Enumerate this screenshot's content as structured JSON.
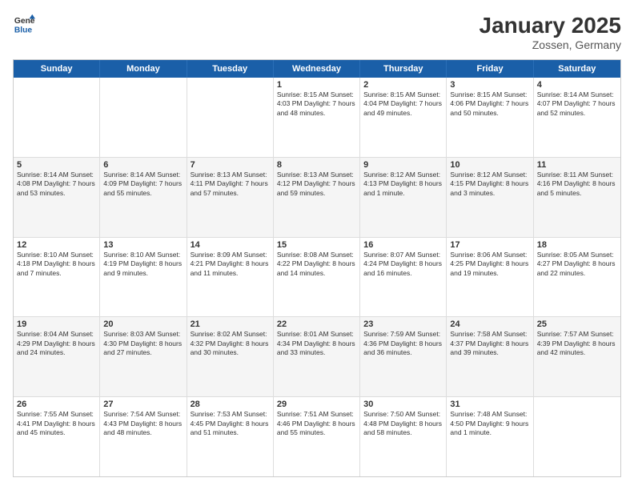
{
  "header": {
    "logo_line1": "General",
    "logo_line2": "Blue",
    "title": "January 2025",
    "subtitle": "Zossen, Germany"
  },
  "weekdays": [
    "Sunday",
    "Monday",
    "Tuesday",
    "Wednesday",
    "Thursday",
    "Friday",
    "Saturday"
  ],
  "rows": [
    [
      {
        "day": "",
        "text": ""
      },
      {
        "day": "",
        "text": ""
      },
      {
        "day": "",
        "text": ""
      },
      {
        "day": "1",
        "text": "Sunrise: 8:15 AM\nSunset: 4:03 PM\nDaylight: 7 hours\nand 48 minutes."
      },
      {
        "day": "2",
        "text": "Sunrise: 8:15 AM\nSunset: 4:04 PM\nDaylight: 7 hours\nand 49 minutes."
      },
      {
        "day": "3",
        "text": "Sunrise: 8:15 AM\nSunset: 4:06 PM\nDaylight: 7 hours\nand 50 minutes."
      },
      {
        "day": "4",
        "text": "Sunrise: 8:14 AM\nSunset: 4:07 PM\nDaylight: 7 hours\nand 52 minutes."
      }
    ],
    [
      {
        "day": "5",
        "text": "Sunrise: 8:14 AM\nSunset: 4:08 PM\nDaylight: 7 hours\nand 53 minutes."
      },
      {
        "day": "6",
        "text": "Sunrise: 8:14 AM\nSunset: 4:09 PM\nDaylight: 7 hours\nand 55 minutes."
      },
      {
        "day": "7",
        "text": "Sunrise: 8:13 AM\nSunset: 4:11 PM\nDaylight: 7 hours\nand 57 minutes."
      },
      {
        "day": "8",
        "text": "Sunrise: 8:13 AM\nSunset: 4:12 PM\nDaylight: 7 hours\nand 59 minutes."
      },
      {
        "day": "9",
        "text": "Sunrise: 8:12 AM\nSunset: 4:13 PM\nDaylight: 8 hours\nand 1 minute."
      },
      {
        "day": "10",
        "text": "Sunrise: 8:12 AM\nSunset: 4:15 PM\nDaylight: 8 hours\nand 3 minutes."
      },
      {
        "day": "11",
        "text": "Sunrise: 8:11 AM\nSunset: 4:16 PM\nDaylight: 8 hours\nand 5 minutes."
      }
    ],
    [
      {
        "day": "12",
        "text": "Sunrise: 8:10 AM\nSunset: 4:18 PM\nDaylight: 8 hours\nand 7 minutes."
      },
      {
        "day": "13",
        "text": "Sunrise: 8:10 AM\nSunset: 4:19 PM\nDaylight: 8 hours\nand 9 minutes."
      },
      {
        "day": "14",
        "text": "Sunrise: 8:09 AM\nSunset: 4:21 PM\nDaylight: 8 hours\nand 11 minutes."
      },
      {
        "day": "15",
        "text": "Sunrise: 8:08 AM\nSunset: 4:22 PM\nDaylight: 8 hours\nand 14 minutes."
      },
      {
        "day": "16",
        "text": "Sunrise: 8:07 AM\nSunset: 4:24 PM\nDaylight: 8 hours\nand 16 minutes."
      },
      {
        "day": "17",
        "text": "Sunrise: 8:06 AM\nSunset: 4:25 PM\nDaylight: 8 hours\nand 19 minutes."
      },
      {
        "day": "18",
        "text": "Sunrise: 8:05 AM\nSunset: 4:27 PM\nDaylight: 8 hours\nand 22 minutes."
      }
    ],
    [
      {
        "day": "19",
        "text": "Sunrise: 8:04 AM\nSunset: 4:29 PM\nDaylight: 8 hours\nand 24 minutes."
      },
      {
        "day": "20",
        "text": "Sunrise: 8:03 AM\nSunset: 4:30 PM\nDaylight: 8 hours\nand 27 minutes."
      },
      {
        "day": "21",
        "text": "Sunrise: 8:02 AM\nSunset: 4:32 PM\nDaylight: 8 hours\nand 30 minutes."
      },
      {
        "day": "22",
        "text": "Sunrise: 8:01 AM\nSunset: 4:34 PM\nDaylight: 8 hours\nand 33 minutes."
      },
      {
        "day": "23",
        "text": "Sunrise: 7:59 AM\nSunset: 4:36 PM\nDaylight: 8 hours\nand 36 minutes."
      },
      {
        "day": "24",
        "text": "Sunrise: 7:58 AM\nSunset: 4:37 PM\nDaylight: 8 hours\nand 39 minutes."
      },
      {
        "day": "25",
        "text": "Sunrise: 7:57 AM\nSunset: 4:39 PM\nDaylight: 8 hours\nand 42 minutes."
      }
    ],
    [
      {
        "day": "26",
        "text": "Sunrise: 7:55 AM\nSunset: 4:41 PM\nDaylight: 8 hours\nand 45 minutes."
      },
      {
        "day": "27",
        "text": "Sunrise: 7:54 AM\nSunset: 4:43 PM\nDaylight: 8 hours\nand 48 minutes."
      },
      {
        "day": "28",
        "text": "Sunrise: 7:53 AM\nSunset: 4:45 PM\nDaylight: 8 hours\nand 51 minutes."
      },
      {
        "day": "29",
        "text": "Sunrise: 7:51 AM\nSunset: 4:46 PM\nDaylight: 8 hours\nand 55 minutes."
      },
      {
        "day": "30",
        "text": "Sunrise: 7:50 AM\nSunset: 4:48 PM\nDaylight: 8 hours\nand 58 minutes."
      },
      {
        "day": "31",
        "text": "Sunrise: 7:48 AM\nSunset: 4:50 PM\nDaylight: 9 hours\nand 1 minute."
      },
      {
        "day": "",
        "text": ""
      }
    ]
  ]
}
